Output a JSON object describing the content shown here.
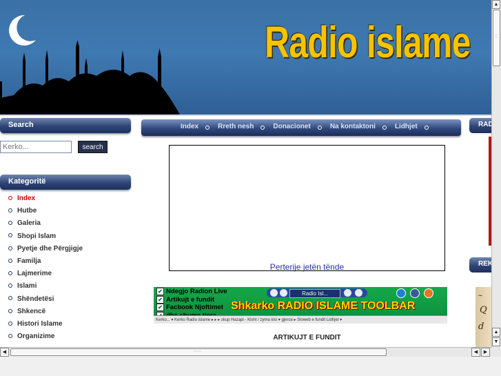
{
  "header": {
    "title": "Radio islame"
  },
  "sidebar": {
    "search_heading": "Search",
    "search_placeholder": "Kerko...",
    "search_button": "search",
    "categories_heading": "Kategoritë",
    "categories": [
      {
        "label": "Index",
        "active": true
      },
      {
        "label": "Hutbe",
        "active": false
      },
      {
        "label": "Galeria",
        "active": false
      },
      {
        "label": "Shopi Islam",
        "active": false
      },
      {
        "label": "Pyetje dhe Përgjigje",
        "active": false
      },
      {
        "label": "Familja",
        "active": false
      },
      {
        "label": "Lajmerime",
        "active": false
      },
      {
        "label": "Islami",
        "active": false
      },
      {
        "label": "Shëndetësi",
        "active": false
      },
      {
        "label": "Shkencë",
        "active": false
      },
      {
        "label": "Histori Islame",
        "active": false
      },
      {
        "label": "Organizime",
        "active": false
      }
    ]
  },
  "nav": {
    "items": [
      "Index",
      "Rreth nesh",
      "Donacionet",
      "Na kontaktoni",
      "Lidhjet"
    ]
  },
  "main": {
    "player_link": "Perterije jetën tënde",
    "toolbar_ad": {
      "checks": [
        "Ndegjo Radion Live",
        "Artikujt e fundit",
        "Facbook Njoftimet",
        "dhe shume tjera..."
      ],
      "player_label": "Radio Isl...",
      "headline": "Shkarko RADIO ISLAME TOOLBAR",
      "strip_text": "Kerko...   ▾   Kerko   Radio islame   ▸ ▸ ▸   skup Hazapi - Kisht / zyma kisi  ▾  gjerce ▸   Sloweb e fundit  Lidhjet ▾"
    },
    "recent_heading": "ARTIKUJT E FUNDIT"
  },
  "right_column": {
    "heading_1": "RAD",
    "heading_2": "REK"
  },
  "colors": {
    "banner_blue": "#3f79b1",
    "title_yellow": "#f5c400",
    "nav_dark": "#1e3060",
    "active_red": "#cc0000",
    "ad_green": "#15a84a"
  }
}
